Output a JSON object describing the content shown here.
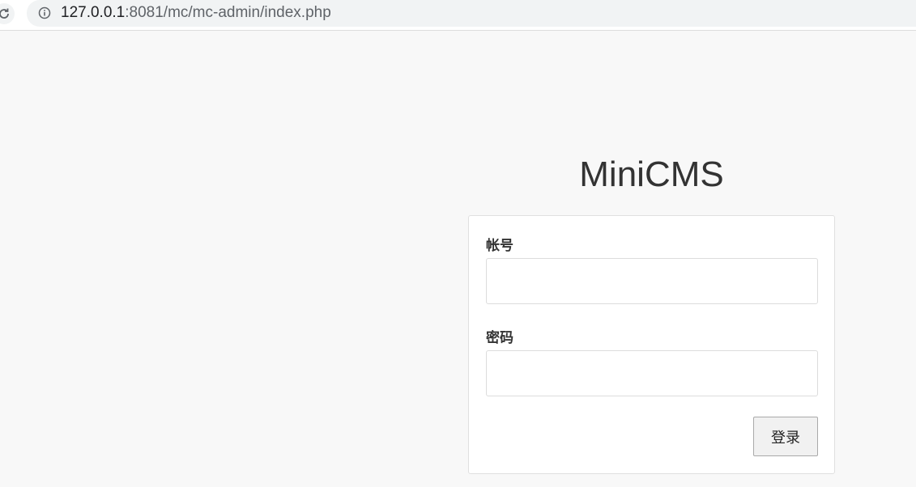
{
  "browser": {
    "url_host": "127.0.0.1",
    "url_rest": ":8081/mc/mc-admin/index.php"
  },
  "page": {
    "title": "MiniCMS"
  },
  "login_form": {
    "account_label": "帐号",
    "account_value": "",
    "password_label": "密码",
    "password_value": "",
    "submit_label": "登录"
  }
}
